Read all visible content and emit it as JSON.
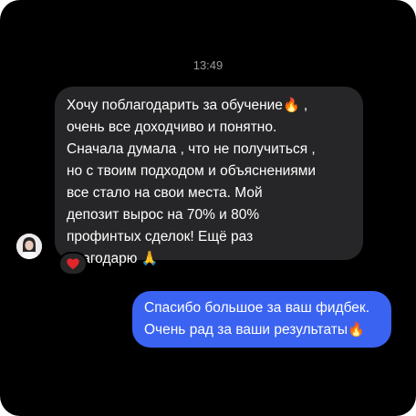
{
  "chat": {
    "timestamp": "13:49",
    "incoming": {
      "lines": [
        "Хочу поблагодарить за обучение",
        "очень все доходчиво и понятно.",
        "Сначала думала , что не получиться ,",
        "но с твоим подходом и объяснениями",
        "все стало на свои места. Мой",
        "депозит вырос на 70% и 80%",
        "профинтых сделок! Ещё раз",
        "благодарю"
      ],
      "emoji_after_line1": "🔥",
      "line1_suffix": " ,",
      "emoji_end": "🙏",
      "reaction": "❤️",
      "reaction_icon": "heart-icon",
      "avatar_icon": "user-avatar"
    },
    "outgoing": {
      "lines": [
        "Спасибо большое за ваш фидбек.",
        "Очень рад за ваши результаты"
      ],
      "emoji_end": "🔥"
    }
  },
  "colors": {
    "background": "#000000",
    "incoming_bubble": "#262628",
    "outgoing_bubble": "#3a63f2",
    "timestamp": "#9a9a9e"
  }
}
